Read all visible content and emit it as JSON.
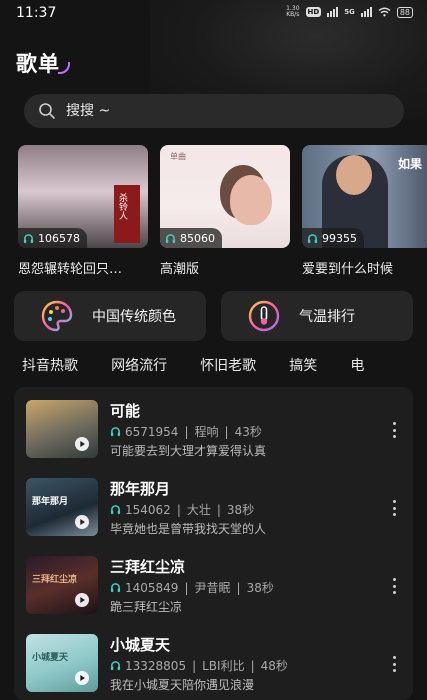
{
  "status_bar": {
    "time": "11:37",
    "speed_value": "1.30",
    "speed_unit": "KB/s",
    "hd": "HD",
    "network": "5G",
    "battery": "88"
  },
  "header": {
    "title": "歌单"
  },
  "search": {
    "placeholder": "搜搜 ~"
  },
  "playlists": [
    {
      "title": "恩怨辗转轮回只…",
      "plays": "106578",
      "cover_text": "杀铃人"
    },
    {
      "title": "高潮版",
      "plays": "85060",
      "cover_text": "单曲"
    },
    {
      "title": "爱要到什么时候",
      "plays": "99355",
      "cover_text": "如果"
    }
  ],
  "features": [
    {
      "label": "中国传统颜色",
      "icon": "palette-icon"
    },
    {
      "label": "气温排行",
      "icon": "thermometer-icon"
    }
  ],
  "tabs": [
    "抖音热歌",
    "网络流行",
    "怀旧老歌",
    "搞笑",
    "电"
  ],
  "songs": [
    {
      "title": "可能",
      "plays": "6571954",
      "artist": "程响",
      "duration": "43秒",
      "lyric": "可能要去到大理才算爱得认真"
    },
    {
      "title": "那年那月",
      "plays": "154062",
      "artist": "大壮",
      "duration": "38秒",
      "lyric": "毕竟她也是曾带我找天堂的人",
      "thumb_text": "那年那月"
    },
    {
      "title": "三拜红尘凉",
      "plays": "1405849",
      "artist": "尹昔眠",
      "duration": "38秒",
      "lyric": "跪三拜红尘凉",
      "thumb_text": "三拜红尘凉"
    },
    {
      "title": "小城夏天",
      "plays": "13328805",
      "artist": "LBI利比",
      "duration": "48秒",
      "lyric": "我在小城夏天陪你遇见浪漫",
      "thumb_text": "小城夏天"
    }
  ],
  "colors": {
    "background": "#141414",
    "card": "#262626",
    "accent": "#c070ff",
    "teal": "#3fd1c2"
  }
}
